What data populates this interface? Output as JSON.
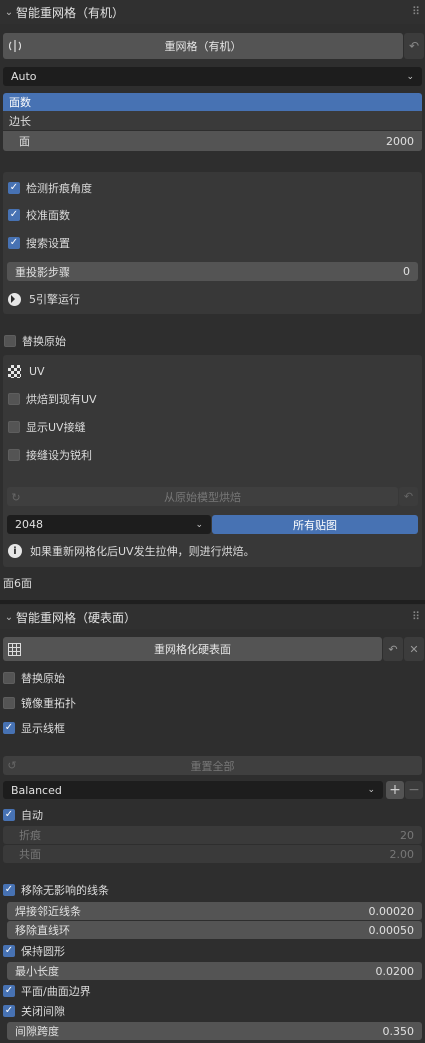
{
  "organic": {
    "header": "智能重网格（有机）",
    "remesh_button": "重网格（有机）",
    "mode_select": "Auto",
    "list": [
      "面数",
      "边长"
    ],
    "faces_field": {
      "label": "面",
      "value": "2000"
    },
    "checks": [
      {
        "label": "检测折痕角度",
        "checked": true
      },
      {
        "label": "校准面数",
        "checked": true
      },
      {
        "label": "搜索设置",
        "checked": true
      }
    ],
    "reproject": {
      "label": "重投影步骤",
      "value": "0"
    },
    "engine_text": "5引擎运行",
    "replace_original": {
      "label": "替换原始",
      "checked": false
    },
    "uv_header": "UV",
    "uv_checks": [
      {
        "label": "烘焙到现有UV",
        "checked": false
      },
      {
        "label": "显示UV接缝",
        "checked": false
      },
      {
        "label": "接缝设为锐利",
        "checked": false
      }
    ],
    "bake_button": "从原始模型烘焙",
    "resolution": "2048",
    "all_maps_button": "所有贴图",
    "info_text": "如果重新网格化后UV发生拉伸，则进行烘焙。",
    "face_count": "面6面"
  },
  "hard": {
    "header": "智能重网格（硬表面）",
    "remesh_button": "重网格化硬表面",
    "checks": [
      {
        "label": "替换原始",
        "checked": false
      },
      {
        "label": "镜像重拓扑",
        "checked": false
      },
      {
        "label": "显示线框",
        "checked": true
      }
    ],
    "reset_button": "重置全部",
    "preset_select": "Balanced",
    "auto": {
      "label": "自动",
      "checked": true
    },
    "crease": {
      "label": "折痕",
      "value": "20"
    },
    "coplanar": {
      "label": "共面",
      "value": "2.00"
    },
    "remove_edges": {
      "label": "移除无影响的线条",
      "checked": true
    },
    "weld": {
      "label": "焊接邻近线条",
      "value": "0.00020"
    },
    "remove_straight": {
      "label": "移除直线环",
      "value": "0.00050"
    },
    "keep_round": {
      "label": "保持圆形",
      "checked": true
    },
    "min_length": {
      "label": "最小长度",
      "value": "0.0200"
    },
    "flat_boundary": {
      "label": "平面/曲面边界",
      "checked": true
    },
    "close_gaps": {
      "label": "关闭间隙",
      "checked": true
    },
    "gap_span": {
      "label": "间隙跨度",
      "value": "0.350"
    }
  },
  "colors": {
    "accent": "#4772b3",
    "panel": "#2e2e2e",
    "field": "#545454"
  }
}
